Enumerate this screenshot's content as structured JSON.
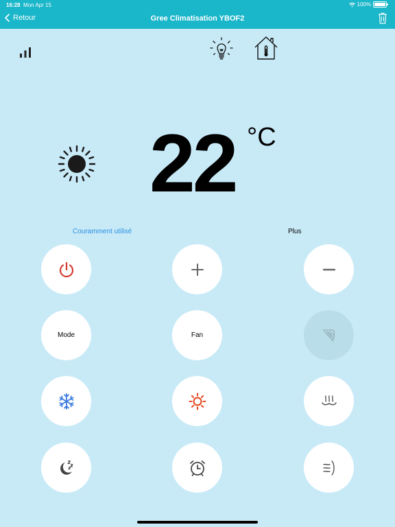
{
  "status_bar": {
    "time": "16:28",
    "date": "Mon Apr 15",
    "battery": "100%"
  },
  "nav": {
    "back_label": "Retour",
    "title": "Gree Climatisation YBOF2"
  },
  "display": {
    "temperature": "22",
    "unit": "°C",
    "mode_icon": "sun-icon"
  },
  "tabs": {
    "frequent": "Couramment utilisé",
    "more": "Plus"
  },
  "buttons": {
    "mode": "Mode",
    "fan": "Fan"
  },
  "colors": {
    "header": "#1ab6c9",
    "background": "#c8eaf7",
    "power": "#d43a2f",
    "cool": "#3a7be0",
    "heat": "#e8441c",
    "tab_active": "#2a8ee0"
  }
}
